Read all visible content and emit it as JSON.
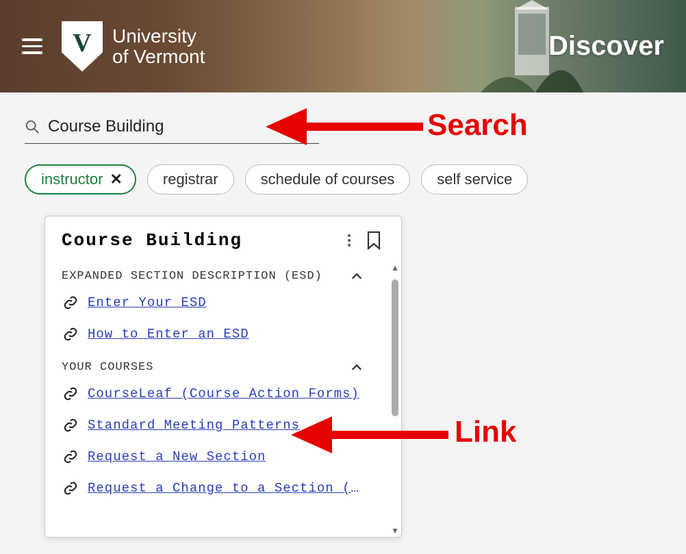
{
  "header": {
    "university_line1": "University",
    "university_line2": "of Vermont",
    "shield_letter": "V",
    "discover": "Discover"
  },
  "search": {
    "value": "Course Building"
  },
  "chips": [
    {
      "label": "instructor",
      "active": true
    },
    {
      "label": "registrar",
      "active": false
    },
    {
      "label": "schedule of courses",
      "active": false
    },
    {
      "label": "self service",
      "active": false
    }
  ],
  "card": {
    "title": "Course Building",
    "sections": [
      {
        "title": "EXPANDED SECTION DESCRIPTION (ESD)",
        "links": [
          "Enter Your ESD",
          "How to Enter an ESD"
        ]
      },
      {
        "title": "YOUR COURSES",
        "links": [
          "CourseLeaf (Course Action Forms)",
          "Standard Meeting Patterns",
          "Request a New Section",
          "Request a Change to a Section (Time/Day/Ca…"
        ]
      }
    ]
  },
  "annotations": {
    "search_label": "Search",
    "link_label": "Link"
  }
}
